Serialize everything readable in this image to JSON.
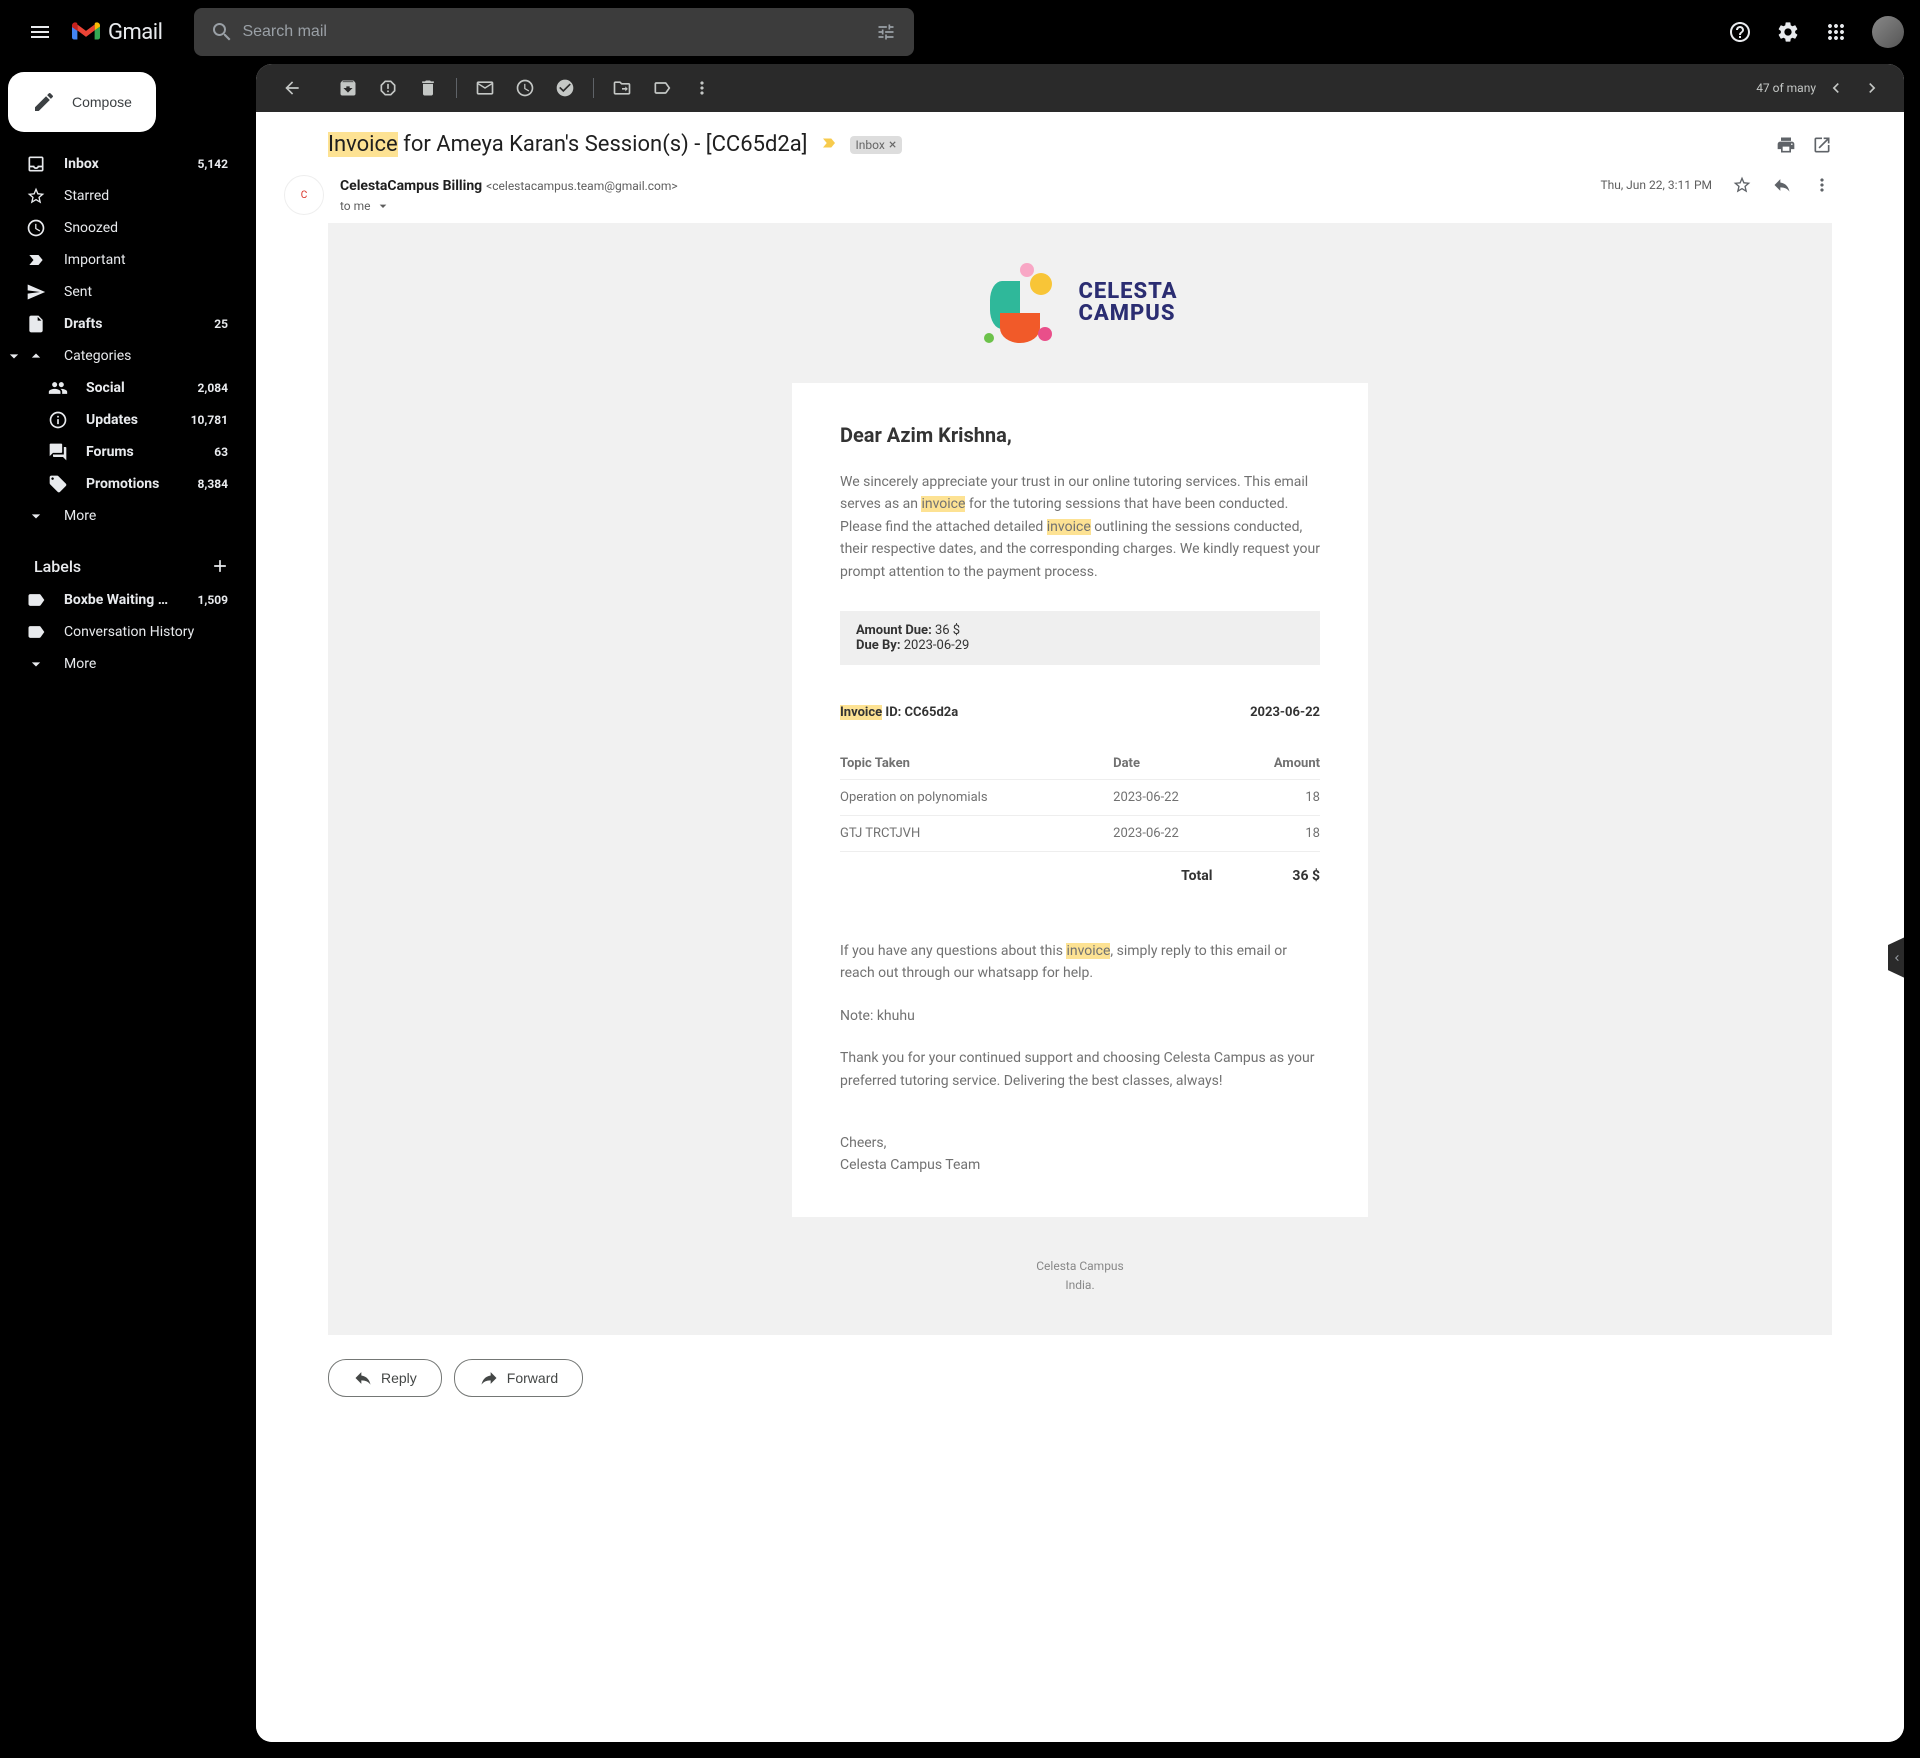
{
  "app": {
    "name": "Gmail"
  },
  "search": {
    "placeholder": "Search mail"
  },
  "compose_label": "Compose",
  "nav": [
    {
      "icon": "inbox",
      "label": "Inbox",
      "count": "5,142",
      "bold": true
    },
    {
      "icon": "star",
      "label": "Starred",
      "count": "",
      "bold": false
    },
    {
      "icon": "snooze",
      "label": "Snoozed",
      "count": "",
      "bold": false
    },
    {
      "icon": "important",
      "label": "Important",
      "count": "",
      "bold": false
    },
    {
      "icon": "sent",
      "label": "Sent",
      "count": "",
      "bold": false
    },
    {
      "icon": "drafts",
      "label": "Drafts",
      "count": "25",
      "bold": true
    },
    {
      "icon": "categories",
      "label": "Categories",
      "count": "",
      "bold": false,
      "expand": true
    }
  ],
  "categories": [
    {
      "icon": "social",
      "label": "Social",
      "count": "2,084",
      "bold": true
    },
    {
      "icon": "updates",
      "label": "Updates",
      "count": "10,781",
      "bold": true
    },
    {
      "icon": "forums",
      "label": "Forums",
      "count": "63",
      "bold": true
    },
    {
      "icon": "promotions",
      "label": "Promotions",
      "count": "8,384",
      "bold": true
    }
  ],
  "more_label": "More",
  "labels_header": "Labels",
  "labels": [
    {
      "icon": "label",
      "label": "Boxbe Waiting …",
      "count": "1,509",
      "bold": true
    },
    {
      "icon": "label",
      "label": "Conversation History",
      "count": "",
      "bold": false
    }
  ],
  "toolbar": {
    "position": "47 of many"
  },
  "subject": {
    "hl": "Invoice",
    "rest": " for Ameya Karan's Session(s) - [CC65d2a]"
  },
  "chip": {
    "label": "Inbox",
    "x": "×"
  },
  "sender": {
    "name": "CelestaCampus Billing",
    "email": "<celestacampus.team@gmail.com>",
    "to": "to me",
    "date": "Thu, Jun 22, 3:11 PM"
  },
  "logo": {
    "line1": "CELESTA",
    "line2": "CAMPUS"
  },
  "email": {
    "greeting": "Dear Azim Krishna,",
    "p1a": "We sincerely appreciate your trust in our online tutoring services. This email serves as an ",
    "p1_hl": "invoice",
    "p1b": " for the tutoring sessions that have been conducted.",
    "p2a": "Please find the attached detailed ",
    "p2_hl": "invoice",
    "p2b": " outlining the sessions conducted, their respective dates, and the corresponding charges. We kindly request your prompt attention to the payment process.",
    "amount_due_label": "Amount Due:",
    "amount_due_value": " 36 $",
    "due_by_label": "Due By:",
    "due_by_value": " 2023-06-29",
    "invoice_id_hl": "Invoice",
    "invoice_id_rest": " ID: CC65d2a",
    "invoice_date": "2023-06-22",
    "th1": "Topic Taken",
    "th2": "Date",
    "th3": "Amount",
    "rows": [
      {
        "topic": "Operation on polynomials",
        "date": "2023-06-22",
        "amount": "18"
      },
      {
        "topic": "GTJ TRCTJVH",
        "date": "2023-06-22",
        "amount": "18"
      }
    ],
    "total_label": "Total",
    "total_value": "36 $",
    "p3a": "If you have any questions about this ",
    "p3_hl": "invoice",
    "p3b": ", simply reply to this email or reach out through our whatsapp for help.",
    "note": "Note: khuhu",
    "p4": "Thank you for your continued support and choosing Celesta Campus as your preferred tutoring service. Delivering the best classes, always!",
    "signoff1": "Cheers,",
    "signoff2": "Celesta Campus Team",
    "footer1": "Celesta Campus",
    "footer2": "India."
  },
  "reply_label": "Reply",
  "forward_label": "Forward"
}
